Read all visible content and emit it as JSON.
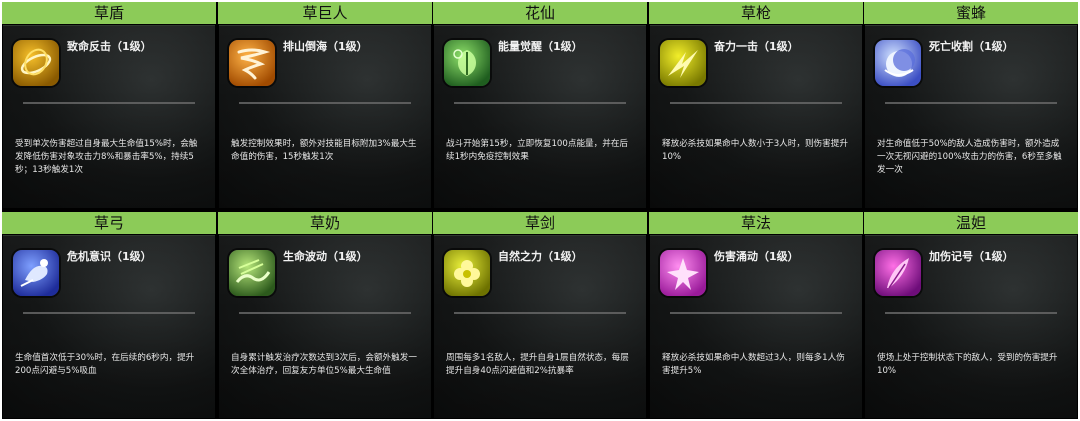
{
  "rows": [
    {
      "cards": [
        {
          "name": "草盾",
          "skill_title": "致命反击（1级）",
          "icon": "gold-swirl-icon",
          "colors": [
            "#f6c02a",
            "#8a5a00"
          ],
          "desc": "受到单次伤害超过自身最大生命值15%时，会触发降低伤害对象攻击力8%和暴击率5%，持续5秒；13秒触发1次"
        },
        {
          "name": "草巨人",
          "skill_title": "排山倒海（1级）",
          "icon": "orange-tornado-icon",
          "colors": [
            "#ffb347",
            "#a14b00"
          ],
          "desc": "触发控制效果时，额外对技能目标附加3%最大生命值的伤害，15秒触发1次"
        },
        {
          "name": "花仙",
          "skill_title": "能量觉醒（1级）",
          "icon": "green-leaf-icon",
          "colors": [
            "#8ee06a",
            "#1f5e1f"
          ],
          "desc": "战斗开始第15秒，立即恢复100点能量，并在后续1秒内免疫控制效果"
        },
        {
          "name": "草枪",
          "skill_title": "奋力一击（1级）",
          "icon": "yellow-strike-icon",
          "colors": [
            "#f2ee2a",
            "#7a7a00"
          ],
          "desc": "释放必杀技如果命中人数小于3人时，则伤害提升10%"
        },
        {
          "name": "蜜蜂",
          "skill_title": "死亡收割（1级）",
          "icon": "blue-moon-icon",
          "colors": [
            "#cfe0ff",
            "#3c4fc4"
          ],
          "desc": "对生命值低于50%的敌人造成伤害时，额外造成一次无视闪避的100%攻击力的伤害，6秒至多触发一次"
        }
      ]
    },
    {
      "cards": [
        {
          "name": "草弓",
          "skill_title": "危机意识（1级）",
          "icon": "blue-runner-icon",
          "colors": [
            "#7fa0ff",
            "#1e2c9a"
          ],
          "desc": "生命值首次低于30%时，在后续的6秒内，提升200点闪避与5%吸血"
        },
        {
          "name": "草奶",
          "skill_title": "生命波动（1级）",
          "icon": "green-wave-icon",
          "colors": [
            "#b6e67a",
            "#2c5a1c"
          ],
          "desc": "自身累计触发治疗次数达到3次后，会额外触发一次全体治疗，回复友方单位5%最大生命值"
        },
        {
          "name": "草剑",
          "skill_title": "自然之力（1级）",
          "icon": "yellow-flower-icon",
          "colors": [
            "#e9ef3a",
            "#6e7200"
          ],
          "desc": "周围每多1名敌人，提升自身1层自然状态，每层提升自身40点闪避值和2%抗暴率"
        },
        {
          "name": "草法",
          "skill_title": "伤害涌动（1级）",
          "icon": "pink-burst-icon",
          "colors": [
            "#ff8ef0",
            "#9a1a9a"
          ],
          "desc": "释放必杀技如果命中人数超过3人，则每多1人伤害提升5%"
        },
        {
          "name": "温妲",
          "skill_title": "加伤记号（1级）",
          "icon": "magenta-feather-icon",
          "colors": [
            "#ff6fe6",
            "#6e0d7a"
          ],
          "desc": "使场上处于控制状态下的敌人，受到的伤害提升10%"
        }
      ]
    }
  ]
}
